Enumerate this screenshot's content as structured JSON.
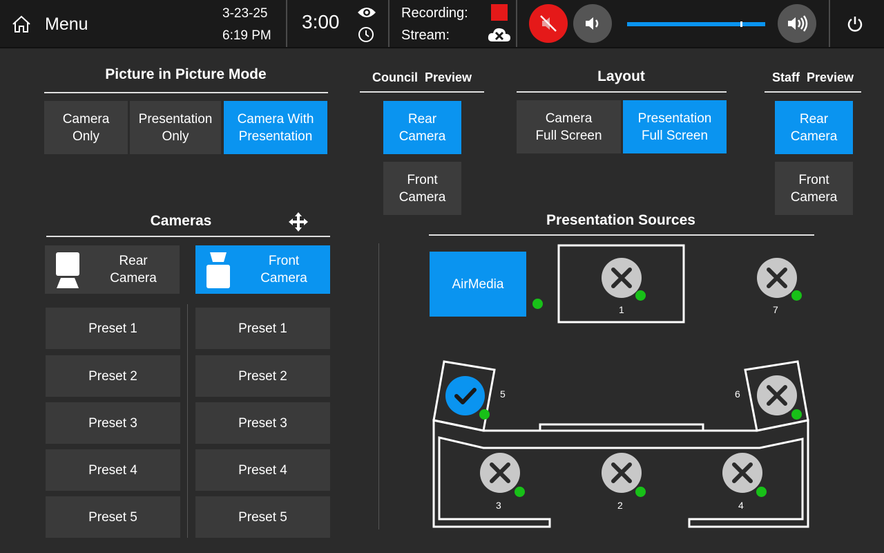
{
  "topbar": {
    "menu_label": "Menu",
    "date": "3-23-25",
    "time": "6:19 PM",
    "timer": "3:00",
    "recording_label": "Recording:",
    "stream_label": "Stream:",
    "volume_level": 0.82
  },
  "pip": {
    "title": "Picture in Picture Mode",
    "buttons": [
      "Camera\nOnly",
      "Presentation\nOnly",
      "Camera With\nPresentation"
    ],
    "active_index": 2
  },
  "council_preview": {
    "title": "Council  Preview",
    "buttons": [
      "Rear\nCamera",
      "Front\nCamera"
    ],
    "active_index": 0
  },
  "layout": {
    "title": "Layout",
    "buttons": [
      "Camera\nFull Screen",
      "Presentation\nFull Screen"
    ],
    "active_index": 1
  },
  "staff_preview": {
    "title": "Staff  Preview",
    "buttons": [
      "Rear\nCamera",
      "Front\nCamera"
    ],
    "active_index": 0
  },
  "cameras": {
    "title": "Cameras",
    "rear_label": "Rear\nCamera",
    "front_label": "Front\nCamera",
    "rear_presets": [
      "Preset 1",
      "Preset 2",
      "Preset 3",
      "Preset 4",
      "Preset 5"
    ],
    "front_presets": [
      "Preset 1",
      "Preset 2",
      "Preset 3",
      "Preset 4",
      "Preset 5"
    ]
  },
  "presentation_sources": {
    "title": "Presentation Sources",
    "airmedia_label": "AirMedia",
    "source_numbers": [
      "1",
      "7",
      "5",
      "6",
      "3",
      "2",
      "4"
    ],
    "selected_source": "5"
  },
  "colors": {
    "accent": "#0a94f0",
    "mute_red": "#e51919",
    "status_green": "#18c018",
    "recording_red": "#e51919"
  }
}
